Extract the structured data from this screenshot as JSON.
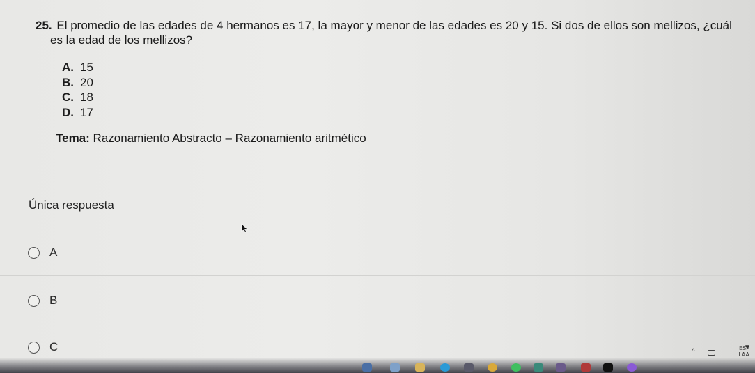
{
  "question": {
    "number": "25.",
    "line1": "El promedio de las edades de 4 hermanos es 17, la mayor y menor de las edades es 20 y 15. Si dos de ellos son mellizos, ¿cuál",
    "line2": "es la edad de los mellizos?"
  },
  "options": [
    {
      "letter": "A.",
      "value": "15"
    },
    {
      "letter": "B.",
      "value": "20"
    },
    {
      "letter": "C.",
      "value": "18"
    },
    {
      "letter": "D.",
      "value": "17"
    }
  ],
  "topic": {
    "label": "Tema:",
    "value": "Razonamiento Abstracto – Razonamiento aritmético"
  },
  "answer": {
    "heading": "Única respuesta",
    "choices": [
      "A",
      "B",
      "C"
    ]
  },
  "tray": {
    "lang": "ESP",
    "region": "LAA"
  },
  "colors": {
    "background": "#e9e9e7",
    "text": "#1a1a1a",
    "taskbar": "#23232d"
  }
}
